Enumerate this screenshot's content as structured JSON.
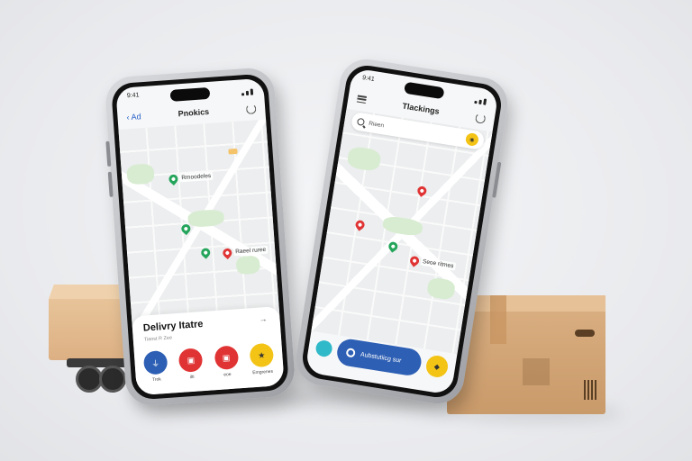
{
  "colors": {
    "brand_blue": "#2d5fb4",
    "pin_green": "#25a55b",
    "pin_red": "#e03434",
    "accent_yellow": "#f3c316",
    "accent_teal": "#30b9c9"
  },
  "phone_left": {
    "status_time": "9:41",
    "appbar": {
      "back_label": "Ad",
      "title": "Pnokics"
    },
    "map_labels": {
      "label_1": "Rmoodeles",
      "label_2": "Raeel ruree"
    },
    "sheet": {
      "title": "Delivry Itatre",
      "subtitle": "Tianst R Zee",
      "actions": [
        {
          "label": "Trok",
          "icon": "pin-icon",
          "color": "#2d5fb4"
        },
        {
          "label": "ilti",
          "icon": "box-icon",
          "color": "#e03434"
        },
        {
          "label": "eoe",
          "icon": "box-icon",
          "color": "#e03434"
        },
        {
          "label": "Emgrenes",
          "icon": "star-icon",
          "color": "#f3c316"
        }
      ]
    }
  },
  "phone_right": {
    "status_time": "9:41",
    "appbar": {
      "title": "Tlackings"
    },
    "search": {
      "placeholder": "Rieen"
    },
    "map_labels": {
      "label_1": "Seoe ritmes"
    },
    "bottom": {
      "track_label": "Aubstutiicg sur"
    }
  }
}
